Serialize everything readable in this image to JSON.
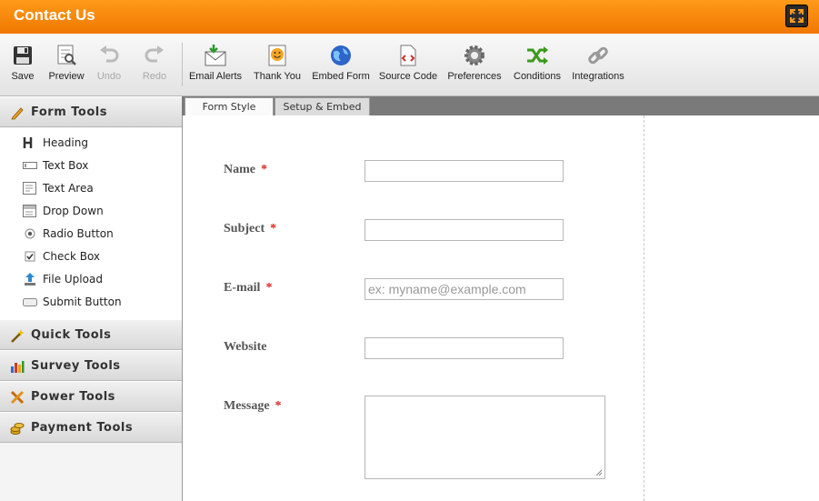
{
  "window": {
    "title": "Contact Us"
  },
  "toolbar": {
    "buttons": [
      {
        "label": "Save",
        "icon": "floppy-disk-icon",
        "enabled": true
      },
      {
        "label": "Preview",
        "icon": "preview-icon",
        "enabled": true
      },
      {
        "label": "Undo",
        "icon": "undo-icon",
        "enabled": false
      },
      {
        "label": "Redo",
        "icon": "redo-icon",
        "enabled": false
      },
      {
        "label": "Email Alerts",
        "icon": "envelope-icon",
        "enabled": true
      },
      {
        "label": "Thank You",
        "icon": "smiley-note-icon",
        "enabled": true
      },
      {
        "label": "Embed Form",
        "icon": "globe-icon",
        "enabled": true
      },
      {
        "label": "Source Code",
        "icon": "code-file-icon",
        "enabled": true
      },
      {
        "label": "Preferences",
        "icon": "gear-icon",
        "enabled": true
      },
      {
        "label": "Conditions",
        "icon": "shuffle-icon",
        "enabled": true
      },
      {
        "label": "Integrations",
        "icon": "chain-link-icon",
        "enabled": true
      }
    ]
  },
  "sidebar": {
    "sections": [
      {
        "label": "Form Tools",
        "icon": "pencil-icon",
        "expanded": true
      },
      {
        "label": "Quick Tools",
        "icon": "magic-wand-icon"
      },
      {
        "label": "Survey Tools",
        "icon": "bar-chart-icon"
      },
      {
        "label": "Power Tools",
        "icon": "crossed-tools-icon"
      },
      {
        "label": "Payment Tools",
        "icon": "coins-icon"
      }
    ],
    "form_tools": [
      {
        "label": "Heading",
        "icon": "heading-icon"
      },
      {
        "label": "Text Box",
        "icon": "textbox-icon"
      },
      {
        "label": "Text Area",
        "icon": "textarea-icon"
      },
      {
        "label": "Drop Down",
        "icon": "dropdown-icon"
      },
      {
        "label": "Radio Button",
        "icon": "radio-icon"
      },
      {
        "label": "Check Box",
        "icon": "checkbox-icon"
      },
      {
        "label": "File Upload",
        "icon": "upload-icon"
      },
      {
        "label": "Submit Button",
        "icon": "submit-button-icon"
      }
    ]
  },
  "tabs": [
    {
      "label": "Form Style",
      "active": true
    },
    {
      "label": "Setup & Embed",
      "active": false
    }
  ],
  "form": {
    "fields": [
      {
        "label": "Name",
        "required": "*",
        "type": "text",
        "value": "",
        "placeholder": ""
      },
      {
        "label": "Subject",
        "required": "*",
        "type": "text",
        "value": "",
        "placeholder": ""
      },
      {
        "label": "E-mail",
        "required": "*",
        "type": "email",
        "value": "",
        "placeholder": "ex: myname@example.com"
      },
      {
        "label": "Website",
        "required": "",
        "type": "text",
        "value": "",
        "placeholder": ""
      },
      {
        "label": "Message",
        "required": "*",
        "type": "textarea",
        "value": ""
      }
    ]
  },
  "colors": {
    "title_bar": "#f48a0c",
    "required_star": "#dd2222",
    "tab_bar": "#7a7a7a"
  }
}
